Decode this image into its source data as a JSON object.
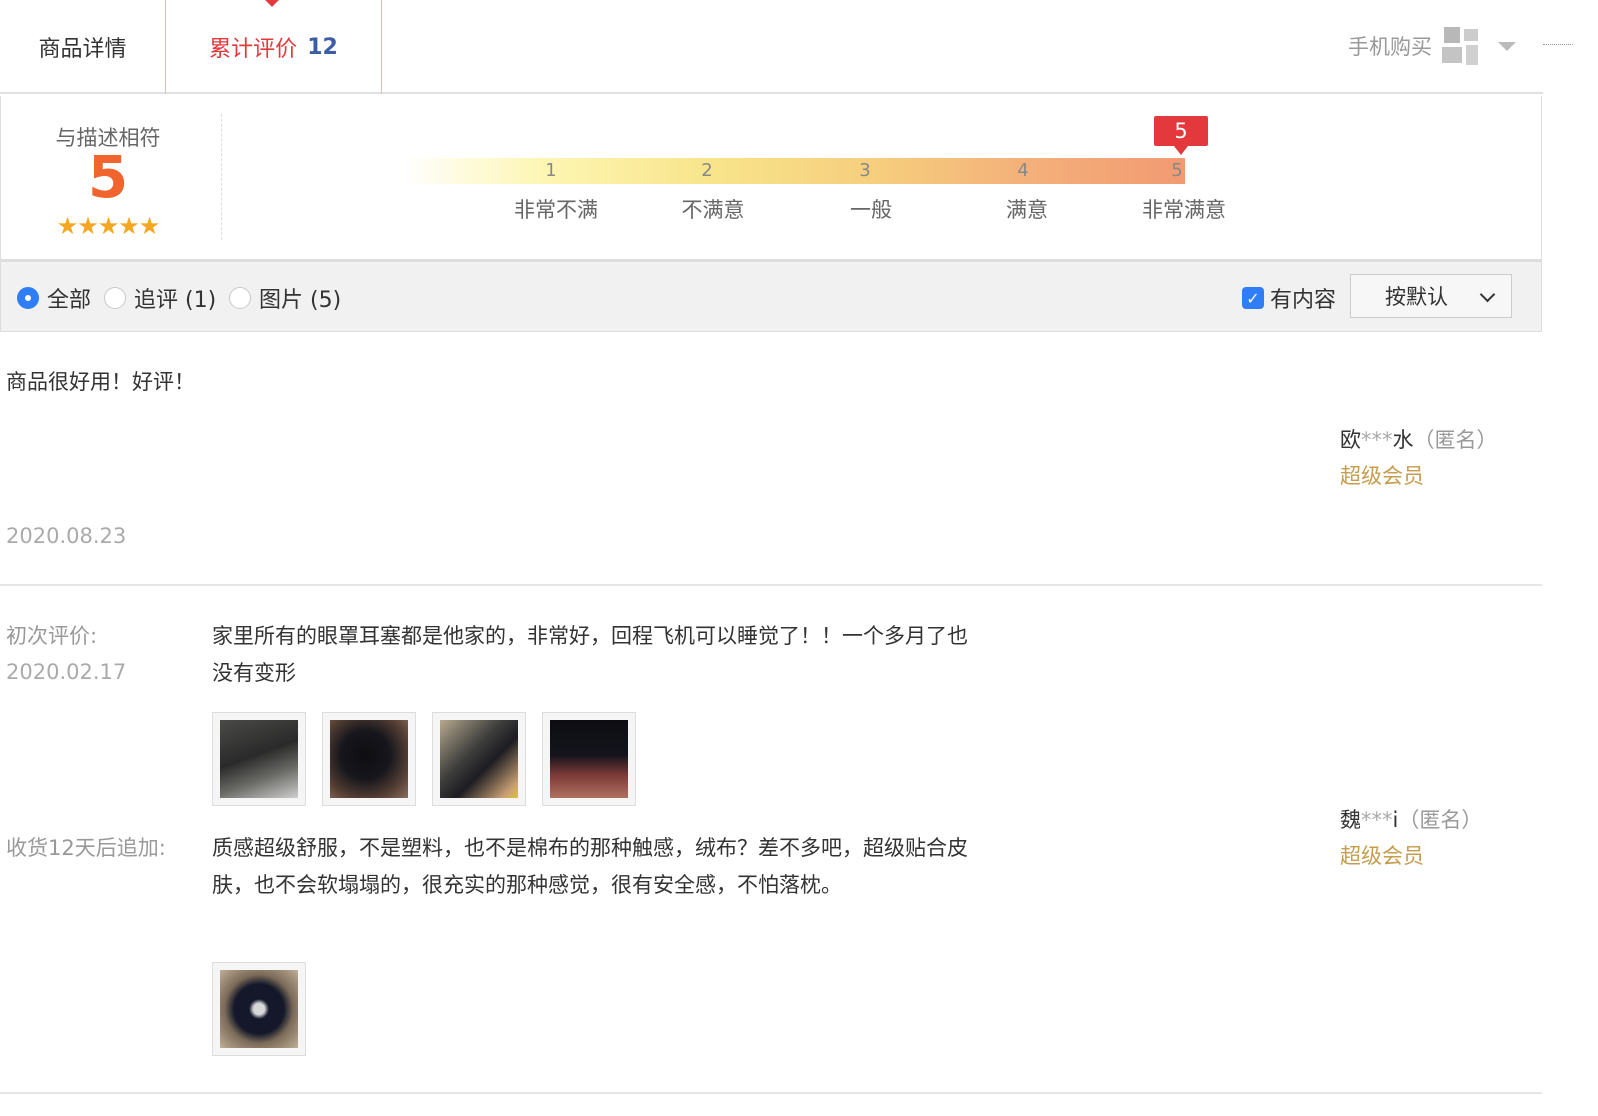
{
  "tabs": {
    "detail_label": "商品详情",
    "reviews_label": "累计评价",
    "reviews_count": "12",
    "mobile_buy_label": "手机购买"
  },
  "summary": {
    "label": "与描述相符",
    "score": "5",
    "stars": "★★★★★",
    "current_score_flag": "5",
    "scale_numbers": [
      "1",
      "2",
      "3",
      "4",
      "5"
    ],
    "scale_texts": [
      "非常不满",
      "不满意",
      "一般",
      "满意",
      "非常满意"
    ],
    "gradient_colors": [
      "#fdf6b3",
      "#f29a72"
    ]
  },
  "filters": {
    "all_label": "全部",
    "followup_label": "追评 (1)",
    "pictures_label": "图片 (5)",
    "has_content_label": "有内容",
    "sort_label": "按默认"
  },
  "reviews": [
    {
      "text": "商品很好用！好评！",
      "date": "2020.08.23",
      "user_prefix": "欧",
      "user_mask": "***",
      "user_suffix": "水",
      "anon": "（匿名）",
      "vip": "超级会员"
    },
    {
      "first_label": "初次评价:",
      "first_date": "2020.02.17",
      "first_text": "家里所有的眼罩耳塞都是他家的，非常好，回程飞机可以睡觉了！！一个多月了也没有变形",
      "followup_label": "收货12天后追加:",
      "followup_text": "质感超级舒服，不是塑料，也不是棉布的那种触感，绒布？差不多吧，超级贴合皮肤，也不会软塌塌的，很充实的那种感觉，很有安全感，不怕落枕。",
      "user_prefix": "魏",
      "user_mask": "***",
      "user_suffix": "i",
      "anon": "（匿名）",
      "vip": "超级会员"
    }
  ],
  "colors": {
    "accent_red": "#e4393c",
    "count_blue": "#3c5ca6",
    "score_orange": "#f0642d",
    "vip_gold": "#c69c4e",
    "checkbox_blue": "#2f7ef5"
  }
}
